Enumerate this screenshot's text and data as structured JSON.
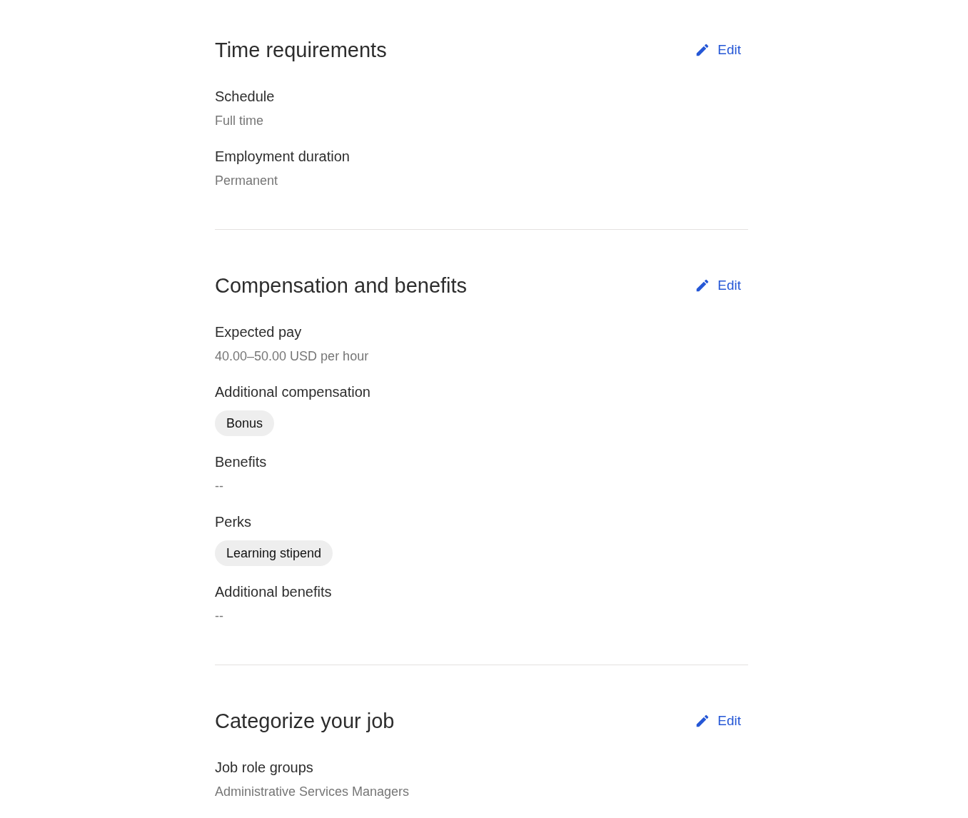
{
  "sections": [
    {
      "title": "Time requirements",
      "edit_label": "Edit",
      "fields": [
        {
          "label": "Schedule",
          "kind": "text",
          "value": "Full time"
        },
        {
          "label": "Employment duration",
          "kind": "text",
          "value": "Permanent"
        }
      ]
    },
    {
      "title": "Compensation and benefits",
      "edit_label": "Edit",
      "fields": [
        {
          "label": "Expected pay",
          "kind": "text",
          "value": "40.00–50.00 USD per hour"
        },
        {
          "label": "Additional compensation",
          "kind": "tags",
          "tags": [
            "Bonus"
          ]
        },
        {
          "label": "Benefits",
          "kind": "text",
          "value": "--"
        },
        {
          "label": "Perks",
          "kind": "tags",
          "tags": [
            "Learning stipend"
          ]
        },
        {
          "label": "Additional benefits",
          "kind": "text",
          "value": "--"
        }
      ]
    },
    {
      "title": "Categorize your job",
      "edit_label": "Edit",
      "fields": [
        {
          "label": "Job role groups",
          "kind": "text",
          "value": "Administrative Services Managers"
        }
      ]
    }
  ]
}
